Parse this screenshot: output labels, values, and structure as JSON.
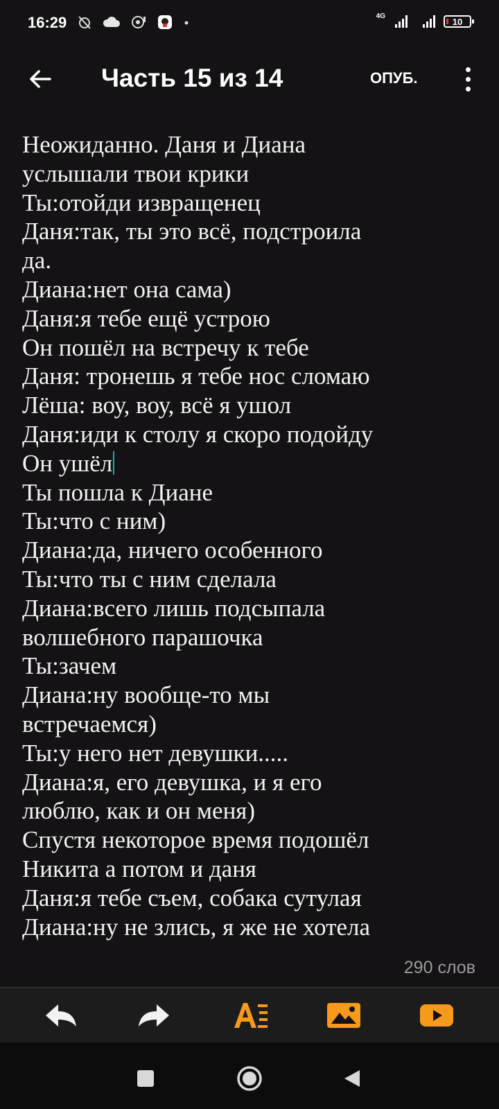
{
  "status_bar": {
    "time": "16:29",
    "network_label": "4G",
    "battery": "10",
    "icons": [
      "alarm-off-icon",
      "cloud-icon",
      "vpn-icon",
      "app-notification-icon",
      "dot-icon"
    ]
  },
  "header": {
    "title": "Часть 15 из 14",
    "publish_label": "ОПУБ."
  },
  "editor": {
    "lines": [
      "Неожиданно. Даня и Диана",
      "услышали твои крики",
      "Ты:отойди извращенец",
      "Даня:так, ты это всё, подстроила",
      "да.",
      "Диана:нет она сама)",
      "Даня:я тебе ещё устрою",
      "Он пошёл на встречу к тебе",
      "Даня: тронешь я тебе нос сломаю",
      "Лёша: воу, воу, всё я ушол",
      "Даня:иди к столу я скоро подойду",
      "Он ушёл",
      "Ты пошла к Диане",
      "Ты:что с ним)",
      "Диана:да, ничего особенного",
      "Ты:что ты с ним сделала",
      "Диана:всего лишь подсыпала",
      "волшебного парашочка",
      "Ты:зачем",
      "Диана:ну вообще-то мы",
      "встречаемся)",
      "Ты:у него нет девушки.....",
      "Диана:я, его девушка, и я его",
      "люблю, как и он меня)",
      "Спустя некоторое время подошёл",
      "Никита а потом и даня",
      "Даня:я тебе съем, собака сутулая",
      "Диана:ну не злись, я же не хотела"
    ],
    "caret_line": 11
  },
  "word_count": "290 слов",
  "colors": {
    "background": "#141214",
    "accent": "#f59a1b",
    "caret": "#19a7b8",
    "toolbar_icon": "#f2f2f2"
  }
}
